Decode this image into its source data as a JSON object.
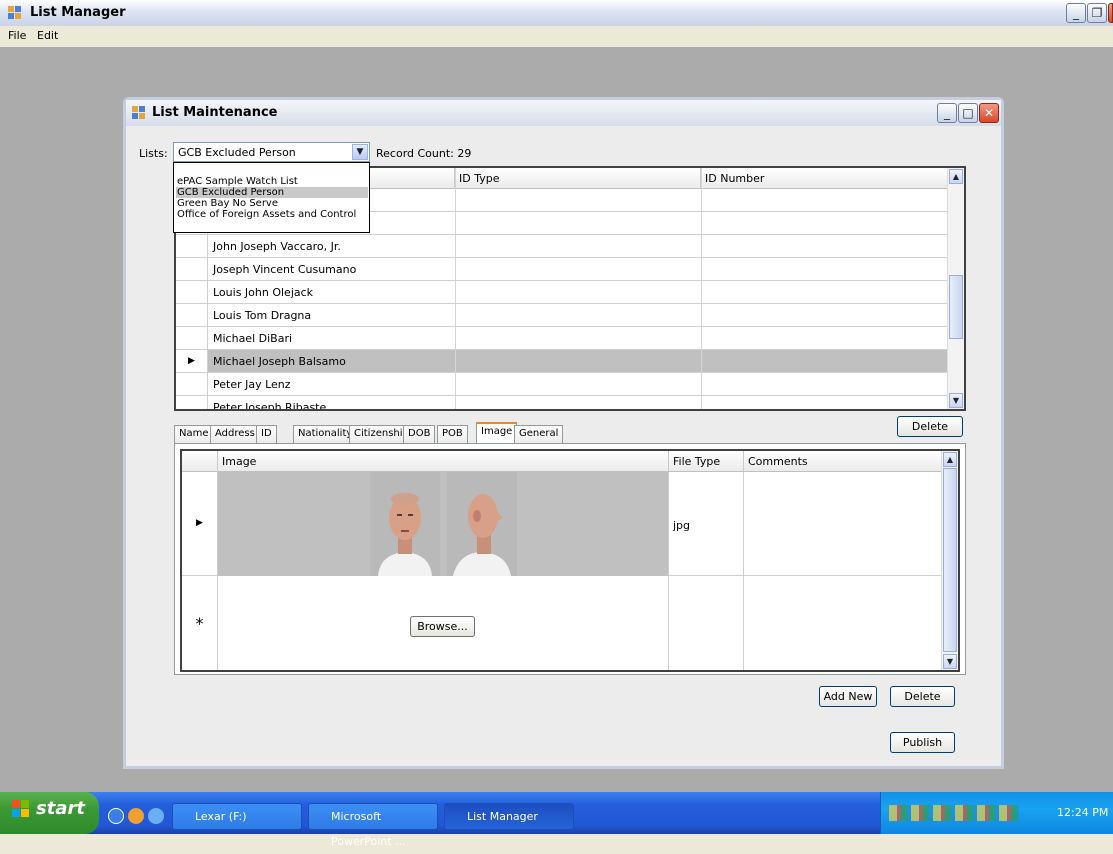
{
  "app": {
    "title": "List Manager",
    "menu": [
      "File",
      "Edit"
    ]
  },
  "child_window": {
    "title": "List Maintenance",
    "lists_label": "Lists:",
    "selected_list": "GCB Excluded Person",
    "record_count": "Record Count: 29",
    "dropdown_options": [
      "ePAC Sample Watch List",
      "GCB Excluded Person",
      "Green Bay No Serve",
      "Office of Foreign Assets and Control"
    ],
    "dropdown_selected_index": 1
  },
  "grid": {
    "columns": [
      "ID Type",
      "ID Number"
    ],
    "rows": [
      "",
      "",
      "John Joseph Vaccaro, Jr.",
      "Joseph Vincent Cusumano",
      "Louis John Olejack",
      "Louis Tom Dragna",
      "Michael DiBari",
      "Michael Joseph Balsamo",
      "Peter Jay Lenz",
      "Peter Joseph Ribaste"
    ],
    "selected_row": 7,
    "delete_label": "Delete"
  },
  "tabs": [
    "Name",
    "Address",
    "ID",
    "Nationality",
    "Citizenship",
    "DOB",
    "POB",
    "Image",
    "General"
  ],
  "active_tab": "Image",
  "image_grid": {
    "columns": [
      "Image",
      "File Type",
      "Comments"
    ],
    "row1_file_type": "jpg",
    "new_row_marker": "*",
    "browse_label": "Browse..."
  },
  "buttons": {
    "add_new": "Add New",
    "delete": "Delete",
    "publish": "Publish"
  },
  "taskbar": {
    "start": "start",
    "items": [
      "Lexar (F:)",
      "Microsoft PowerPoint ...",
      "List Manager"
    ],
    "clock": "12:24 PM"
  },
  "colors": {
    "mdi_background": "#ababab",
    "selected_row": "#c0c0c0",
    "taskbar_blue": "#245edb",
    "start_green": "#3c9a35"
  }
}
